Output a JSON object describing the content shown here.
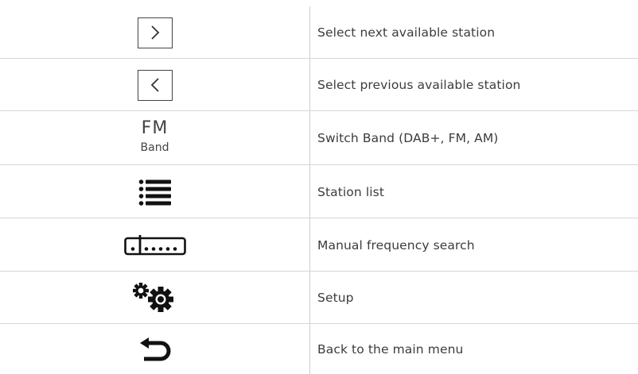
{
  "rows": [
    {
      "icon": "chevron-right-icon",
      "description": "Select next available station"
    },
    {
      "icon": "chevron-left-icon",
      "description": "Select previous available station"
    },
    {
      "icon": "band-icon",
      "band_label": "FM",
      "band_sublabel": "Band",
      "description": "Switch Band (DAB+, FM, AM)"
    },
    {
      "icon": "list-icon",
      "description": "Station list"
    },
    {
      "icon": "frequency-scale-icon",
      "description": "Manual frequency search"
    },
    {
      "icon": "gears-icon",
      "description": "Setup"
    },
    {
      "icon": "back-arrow-icon",
      "description": "Back to the main menu"
    }
  ],
  "colors": {
    "text": "#3c3c3c",
    "icon": "#1a1a1a",
    "divider": "#d6d6d6"
  }
}
